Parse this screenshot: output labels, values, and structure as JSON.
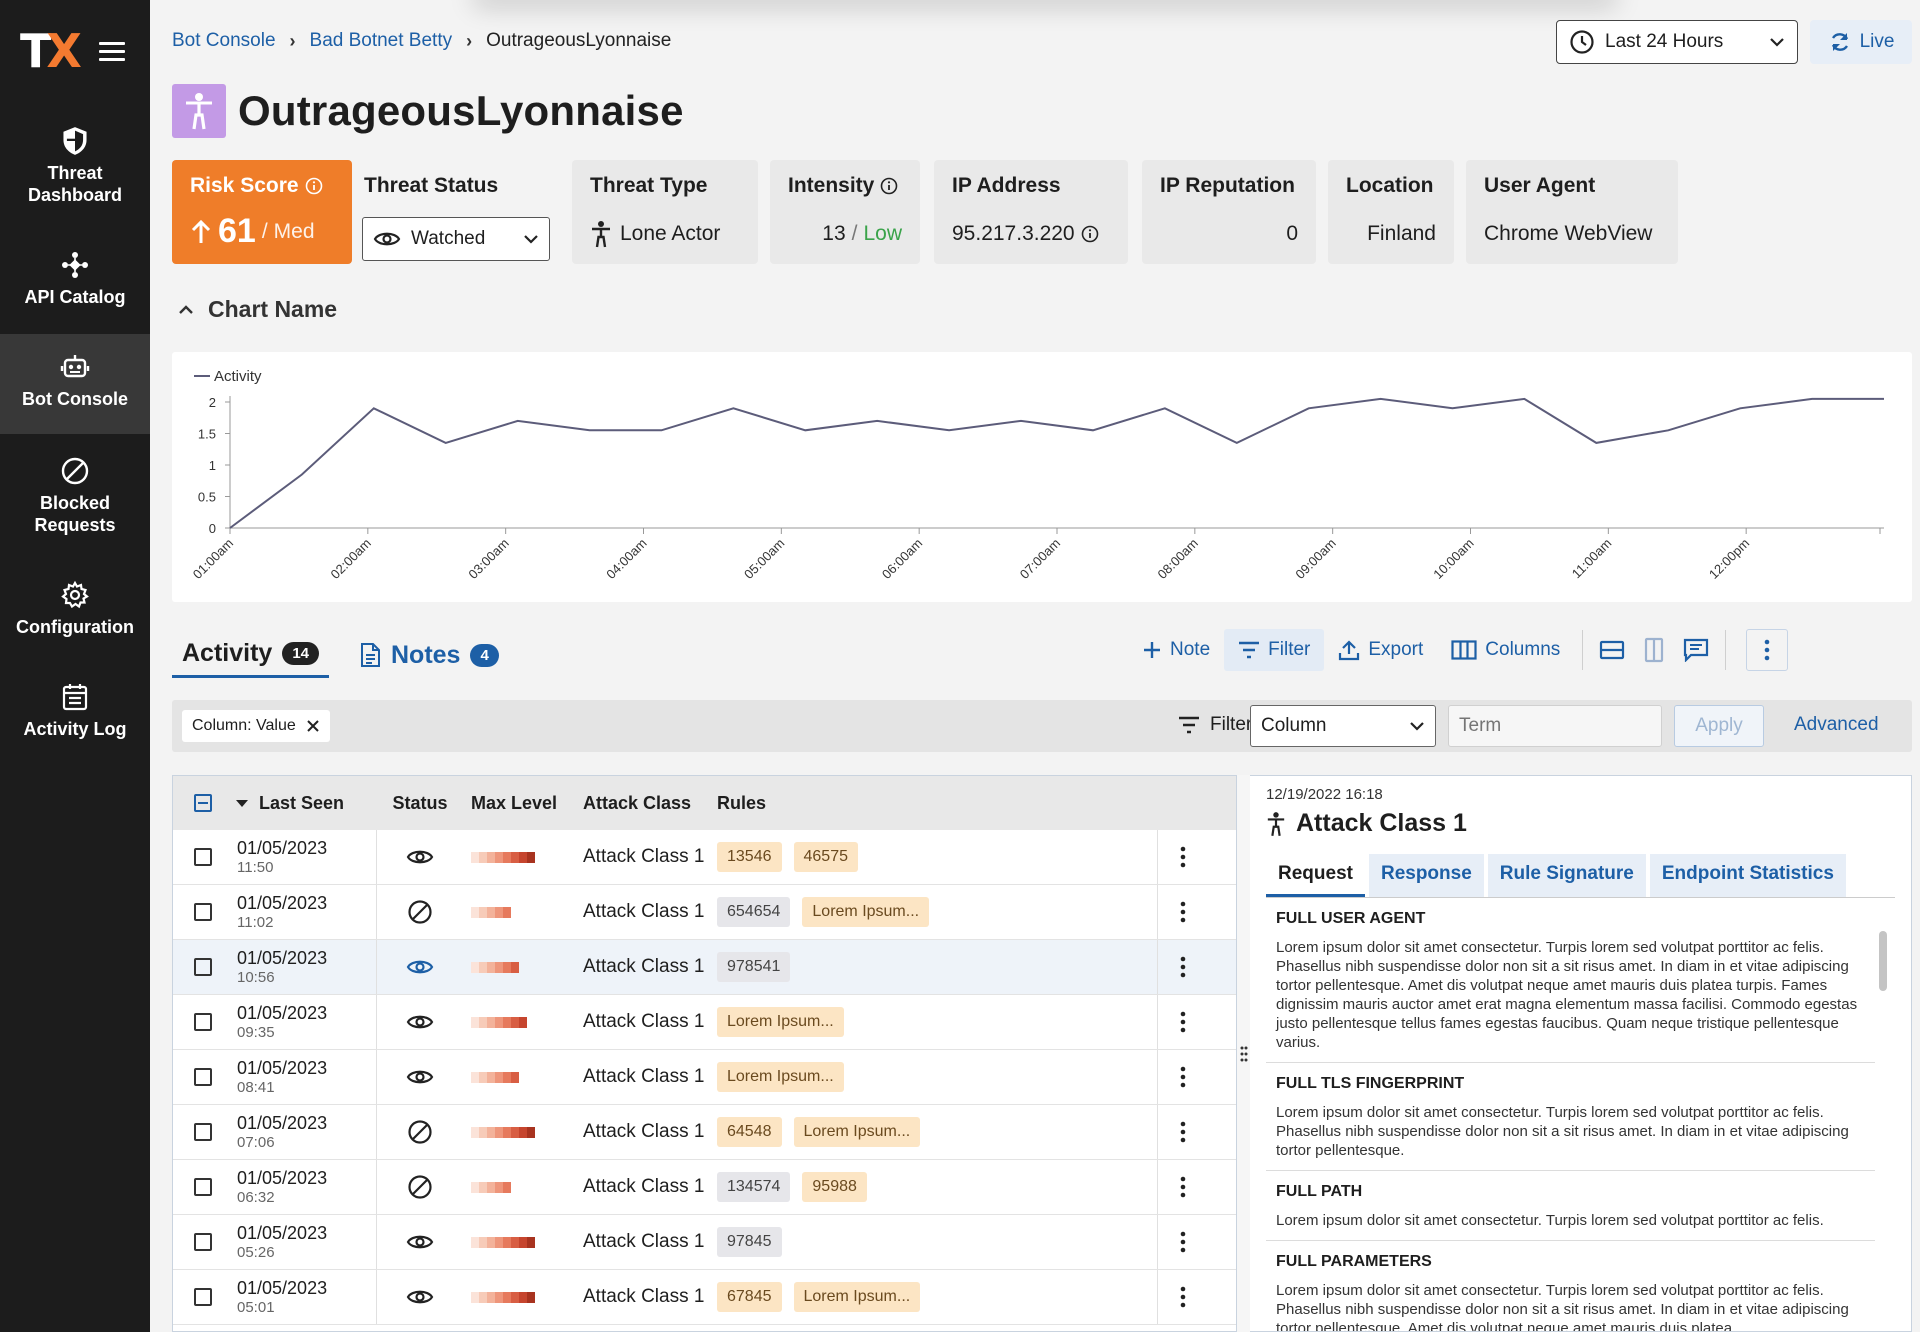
{
  "sidebar": {
    "logo_t": "T",
    "logo_x": "X",
    "items": [
      {
        "label": "Threat Dashboard",
        "icon": "shield-icon"
      },
      {
        "label": "API Catalog",
        "icon": "api-network-icon"
      },
      {
        "label": "Bot Console",
        "icon": "robot-icon",
        "active": true
      },
      {
        "label": "Blocked Requests",
        "icon": "blocked-icon"
      },
      {
        "label": "Configuration",
        "icon": "gear-icon"
      },
      {
        "label": "Activity Log",
        "icon": "calendar-list-icon"
      }
    ]
  },
  "breadcrumb": {
    "items": [
      "Bot Console",
      "Bad Botnet Betty"
    ],
    "current": "OutrageousLyonnaise"
  },
  "time_range": {
    "label": "Last 24 Hours"
  },
  "live": {
    "label": "Live"
  },
  "page_title": "OutrageousLyonnaise",
  "kpis": {
    "risk": {
      "label": "Risk Score",
      "value": "61",
      "level": "Med"
    },
    "threat_status": {
      "label": "Threat Status",
      "value": "Watched"
    },
    "threat_type": {
      "label": "Threat Type",
      "value": "Lone Actor"
    },
    "intensity": {
      "label": "Intensity",
      "value": "13",
      "sep": "/",
      "level": "Low"
    },
    "ip": {
      "label": "IP Address",
      "value": "95.217.3.220"
    },
    "ip_rep": {
      "label": "IP Reputation",
      "value": "0"
    },
    "location": {
      "label": "Location",
      "value": "Finland"
    },
    "user_agent": {
      "label": "User Agent",
      "value": "Chrome WebView"
    }
  },
  "chart_section_label": "Chart Name",
  "chart_data": {
    "type": "line",
    "legend": "Activity",
    "y_ticks": [
      "0",
      "0.5",
      "1",
      "1.5",
      "2"
    ],
    "ylim": [
      0,
      2
    ],
    "x_labels": [
      "01:00am",
      "02:00am",
      "03:00am",
      "04:00am",
      "05:00am",
      "06:00am",
      "07:00am",
      "08:00am",
      "09:00am",
      "10:00am",
      "11:00am",
      "12:00pm"
    ],
    "series": [
      {
        "name": "Activity",
        "color": "#5c5c7a",
        "values": [
          0,
          0.85,
          1.9,
          1.35,
          1.7,
          1.55,
          1.55,
          1.9,
          1.55,
          1.7,
          1.55,
          1.7,
          1.55,
          1.9,
          1.35,
          1.9,
          2.05,
          1.9,
          2.05,
          1.35,
          1.55,
          1.9,
          2.05,
          2.05
        ]
      }
    ]
  },
  "tabs": {
    "activity": {
      "label": "Activity",
      "count": "14"
    },
    "notes": {
      "label": "Notes",
      "count": "4"
    }
  },
  "toolbar": {
    "note": "Note",
    "filter": "Filter",
    "export": "Export",
    "columns": "Columns"
  },
  "filter": {
    "chip": "Column: Value",
    "label": "Filter:",
    "column": "Column",
    "term_placeholder": "Term",
    "apply": "Apply",
    "advanced": "Advanced"
  },
  "table": {
    "headers": {
      "last_seen": "Last Seen",
      "status": "Status",
      "max_level": "Max Level",
      "attack_class": "Attack Class",
      "rules": "Rules"
    },
    "rows": [
      {
        "date": "01/05/2023",
        "time": "11:50",
        "status": "watched",
        "level": 8,
        "attack_class": "Attack Class 1",
        "rules": [
          {
            "t": "13546",
            "c": "o"
          },
          {
            "t": "46575",
            "c": "o"
          }
        ]
      },
      {
        "date": "01/05/2023",
        "time": "11:02",
        "status": "blocked",
        "level": 5,
        "attack_class": "Attack Class 1",
        "rules": [
          {
            "t": "654654",
            "c": "g"
          },
          {
            "t": "Lorem Ipsum...",
            "c": "o"
          }
        ]
      },
      {
        "date": "01/05/2023",
        "time": "10:56",
        "status": "watched-active",
        "level": 6,
        "attack_class": "Attack Class 1",
        "rules": [
          {
            "t": "978541",
            "c": "g"
          }
        ],
        "highlight": true
      },
      {
        "date": "01/05/2023",
        "time": "09:35",
        "status": "watched",
        "level": 7,
        "attack_class": "Attack Class 1",
        "rules": [
          {
            "t": "Lorem Ipsum...",
            "c": "o"
          }
        ]
      },
      {
        "date": "01/05/2023",
        "time": "08:41",
        "status": "watched",
        "level": 6,
        "attack_class": "Attack Class 1",
        "rules": [
          {
            "t": "Lorem Ipsum...",
            "c": "o"
          }
        ]
      },
      {
        "date": "01/05/2023",
        "time": "07:06",
        "status": "blocked",
        "level": 8,
        "attack_class": "Attack Class 1",
        "rules": [
          {
            "t": "64548",
            "c": "o"
          },
          {
            "t": "Lorem Ipsum...",
            "c": "o"
          }
        ]
      },
      {
        "date": "01/05/2023",
        "time": "06:32",
        "status": "blocked",
        "level": 5,
        "attack_class": "Attack Class 1",
        "rules": [
          {
            "t": "134574",
            "c": "g"
          },
          {
            "t": "95988",
            "c": "o"
          }
        ]
      },
      {
        "date": "01/05/2023",
        "time": "05:26",
        "status": "watched",
        "level": 8,
        "attack_class": "Attack Class 1",
        "rules": [
          {
            "t": "97845",
            "c": "g"
          }
        ]
      },
      {
        "date": "01/05/2023",
        "time": "05:01",
        "status": "watched",
        "level": 8,
        "attack_class": "Attack Class 1",
        "rules": [
          {
            "t": "67845",
            "c": "o"
          },
          {
            "t": "Lorem Ipsum...",
            "c": "o"
          }
        ]
      }
    ]
  },
  "detail": {
    "date": "12/19/2022 16:18",
    "title": "Attack Class 1",
    "tabs": [
      "Request",
      "Response",
      "Rule Signature",
      "Endpoint Statistics"
    ],
    "sections": [
      {
        "title": "FULL USER AGENT",
        "text": "Lorem ipsum dolor sit amet consectetur. Turpis lorem sed volutpat porttitor ac felis. Phasellus nibh suspendisse dolor non sit a sit risus amet. In diam in et vitae adipiscing tortor pellentesque. Amet dis volutpat neque amet mauris duis platea turpis. Fames dignissim mauris auctor amet erat magna elementum massa facilisi. Commodo egestas justo pellentesque tellus fames egestas faucibus. Quam neque tristique pellentesque varius."
      },
      {
        "title": "FULL TLS FINGERPRINT",
        "text": "Lorem ipsum dolor sit amet consectetur. Turpis lorem sed volutpat porttitor ac felis. Phasellus nibh suspendisse dolor non sit a sit risus amet. In diam in et vitae adipiscing tortor pellentesque."
      },
      {
        "title": "FULL PATH",
        "text": "Lorem ipsum dolor sit amet consectetur. Turpis lorem sed volutpat porttitor ac felis."
      },
      {
        "title": "FULL PARAMETERS",
        "text": "Lorem ipsum dolor sit amet consectetur. Turpis lorem sed volutpat porttitor ac felis. Phasellus nibh suspendisse dolor non sit a sit risus amet. In diam in et vitae adipiscing tortor pellentesque. Amet dis volutpat neque amet mauris duis platea"
      }
    ]
  },
  "colors": {
    "accent": "#1d5fa6",
    "risk": "#ef7d29",
    "low": "#3aa34a",
    "sidebar": "#1c1c1c"
  }
}
